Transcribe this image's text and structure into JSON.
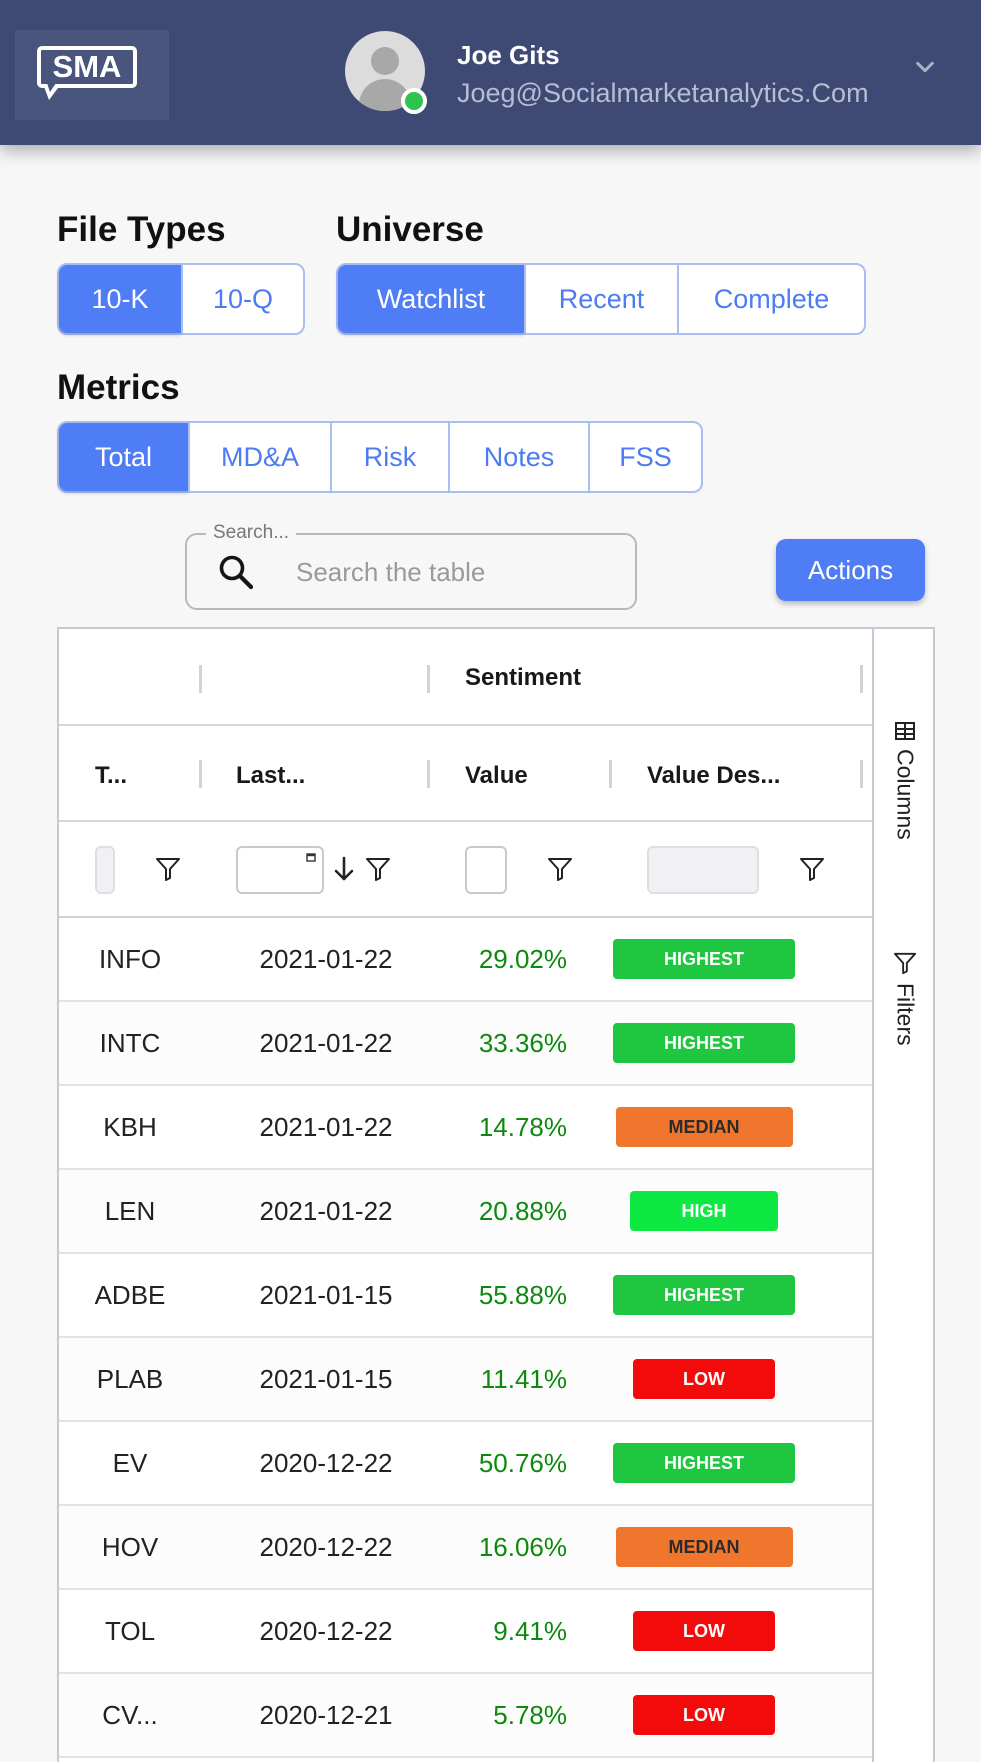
{
  "header": {
    "logo_text": "SMA",
    "user_name": "Joe Gits",
    "user_email": "Joeg@Socialmarketanalytics.Com",
    "online_status_color": "#2dc34f",
    "background_color": "#3e4a74"
  },
  "file_types": {
    "title": "File Types",
    "options": [
      "10-K",
      "10-Q"
    ],
    "selected": "10-K"
  },
  "universe": {
    "title": "Universe",
    "options": [
      "Watchlist",
      "Recent",
      "Complete"
    ],
    "selected": "Watchlist"
  },
  "metrics": {
    "title": "Metrics",
    "options": [
      "Total",
      "MD&A",
      "Risk",
      "Notes",
      "FSS"
    ],
    "selected": "Total"
  },
  "search": {
    "legend": "Search...",
    "placeholder": "Search the table",
    "value": ""
  },
  "actions_label": "Actions",
  "table": {
    "group_header": "Sentiment",
    "columns": [
      "T...",
      "Last...",
      "Value",
      "Value Des..."
    ],
    "sort": {
      "column": "Last...",
      "direction": "descending"
    },
    "side_panel": {
      "columns_label": "Columns",
      "filters_label": "Filters"
    },
    "rows": [
      {
        "ticker": "INFO",
        "date": "2021-01-22",
        "value": "29.02%",
        "desc": "HIGHEST",
        "level": "highest"
      },
      {
        "ticker": "INTC",
        "date": "2021-01-22",
        "value": "33.36%",
        "desc": "HIGHEST",
        "level": "highest"
      },
      {
        "ticker": "KBH",
        "date": "2021-01-22",
        "value": "14.78%",
        "desc": "MEDIAN",
        "level": "median"
      },
      {
        "ticker": "LEN",
        "date": "2021-01-22",
        "value": "20.88%",
        "desc": "HIGH",
        "level": "high"
      },
      {
        "ticker": "ADBE",
        "date": "2021-01-15",
        "value": "55.88%",
        "desc": "HIGHEST",
        "level": "highest"
      },
      {
        "ticker": "PLAB",
        "date": "2021-01-15",
        "value": "11.41%",
        "desc": "LOW",
        "level": "low"
      },
      {
        "ticker": "EV",
        "date": "2020-12-22",
        "value": "50.76%",
        "desc": "HIGHEST",
        "level": "highest"
      },
      {
        "ticker": "HOV",
        "date": "2020-12-22",
        "value": "16.06%",
        "desc": "MEDIAN",
        "level": "median"
      },
      {
        "ticker": "TOL",
        "date": "2020-12-22",
        "value": "9.41%",
        "desc": "LOW",
        "level": "low"
      },
      {
        "ticker": "CV...",
        "date": "2020-12-21",
        "value": "5.78%",
        "desc": "LOW",
        "level": "low"
      }
    ]
  },
  "colors": {
    "accent": "#4f7df5",
    "positive_value": "#0d8a0d",
    "highest": "#1fc63f",
    "high": "#0de843",
    "median": "#f0762d",
    "low": "#f30a0a"
  }
}
